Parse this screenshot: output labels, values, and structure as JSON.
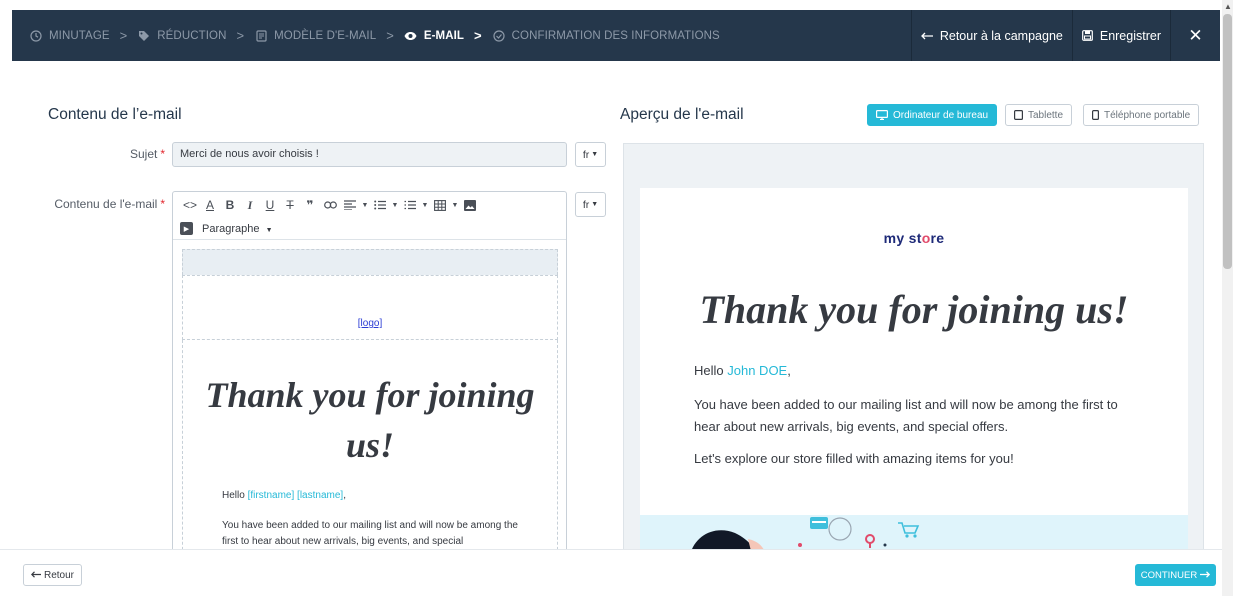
{
  "topbar": {
    "steps": [
      {
        "label": "MINUTAGE",
        "icon": "clock-icon",
        "active": false
      },
      {
        "label": "RÉDUCTION",
        "icon": "tag-icon",
        "active": false
      },
      {
        "label": "MODÈLE D'E-MAIL",
        "icon": "document-icon",
        "active": false
      },
      {
        "label": "E-MAIL",
        "icon": "eye-icon",
        "active": true
      },
      {
        "label": "CONFIRMATION DES INFORMATIONS",
        "icon": "check-circle-icon",
        "active": false
      }
    ],
    "separator": ">",
    "back_to_campaign": "Retour à la campagne",
    "save": "Enregistrer",
    "close": "✕"
  },
  "left": {
    "heading": "Contenu de l’e-mail",
    "subject_label": "Sujet",
    "required_mark": "*",
    "subject_value": "Merci de nous avoir choisis !",
    "lang": "fr",
    "content_label": "Contenu de l'e-mail",
    "paragraph_format": "Paragraphe",
    "editor": {
      "logo": "[logo]",
      "title": "Thank you for joining us!",
      "hello": "Hello",
      "firstname": "[firstname]",
      "lastname": "[lastname]",
      "comma": ",",
      "paragraph": "You have been added to our mailing list and will now be among the first to hear about new arrivals, big events, and special"
    }
  },
  "right": {
    "heading": "Aperçu de l'e-mail",
    "devices": {
      "desktop": "Ordinateur de bureau",
      "tablet": "Tablette",
      "phone": "Téléphone portable"
    },
    "preview": {
      "logo_text_a": "my st",
      "logo_text_o": "o",
      "logo_text_b": "re",
      "title": "Thank you for joining us!",
      "hello": "Hello",
      "name": "John DOE",
      "comma": ",",
      "paragraph": "You have been added to our mailing list and will now be among the first to hear about new arrivals, big events, and special offers.",
      "paragraph2": "Let's explore our store filled with amazing items for you!"
    }
  },
  "footer": {
    "back": "Retour",
    "continue": "CONTINUER"
  },
  "colors": {
    "topbar": "#25374b",
    "accent": "#25b9d7",
    "required": "#e2262d"
  }
}
